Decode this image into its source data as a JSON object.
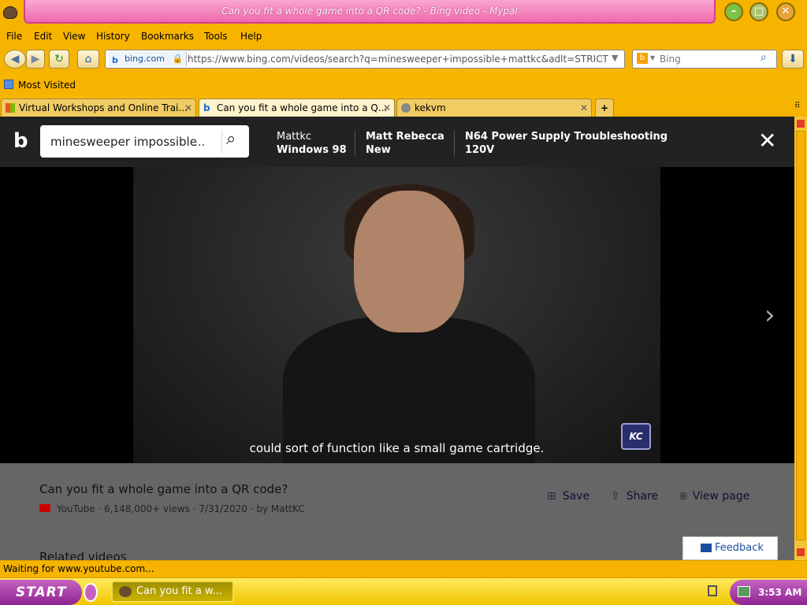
{
  "window": {
    "title": "Can you fit a whole game into a QR code? - Bing video - Mypal"
  },
  "menu": [
    "File",
    "Edit",
    "View",
    "History",
    "Bookmarks",
    "Tools",
    "Help"
  ],
  "nav": {
    "site_label": "bing.com",
    "url": "https://www.bing.com/videos/search?q=minesweeper+impossible+mattkc&adlt=STRICT",
    "search_placeholder": "Bing"
  },
  "bookmarks": {
    "most_visited": "Most Visited"
  },
  "tabs": [
    {
      "label": "Virtual Workshops and Online Trai..."
    },
    {
      "label": "Can you fit a whole game into a Q..."
    },
    {
      "label": "kekvm"
    }
  ],
  "bing": {
    "query": "minesweeper impossible",
    "query_ellipsis": "...",
    "suggestions": [
      {
        "line1": "Mattkc",
        "line2": "Windows 98"
      },
      {
        "line1": "Matt Rebecca",
        "line2": "New"
      },
      {
        "line1": "N64 Power Supply Troubleshooting",
        "line2": "120V"
      }
    ]
  },
  "video": {
    "caption": "could sort of function like a small game cartridge.",
    "watermark": "KC"
  },
  "info": {
    "title": "Can you fit a whole game into a QR code?",
    "source": "YouTube",
    "meta": " · 6,148,000+ views · 7/31/2020 · by MattKC",
    "save": "Save",
    "share": "Share",
    "view_page": "View page",
    "feedback": "Feedback",
    "related": "Related videos"
  },
  "status": "Waiting for www.youtube.com...",
  "taskbar": {
    "start": "START",
    "task": "Can you fit a w...",
    "clock": "3:53 AM"
  },
  "colors": {
    "accent": "#f6b300",
    "title_pink": "#ee69ad",
    "start_purple": "#8f2591"
  }
}
